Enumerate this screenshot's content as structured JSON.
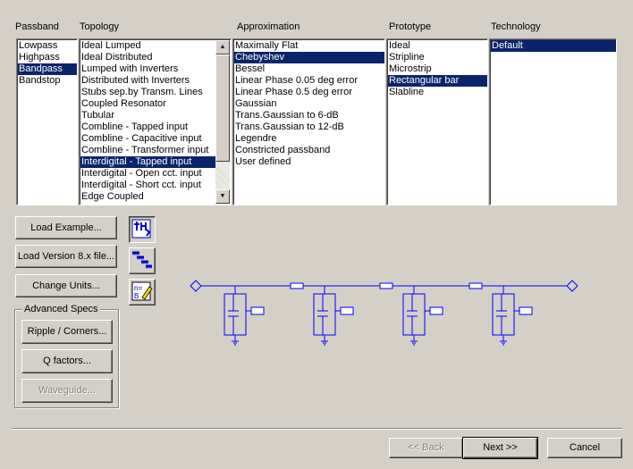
{
  "headers": {
    "passband": "Passband",
    "topology": "Topology",
    "approximation": "Approximation",
    "prototype": "Prototype",
    "technology": "Technology"
  },
  "passband": {
    "items": [
      "Lowpass",
      "Highpass",
      "Bandpass",
      "Bandstop"
    ],
    "selected": "Bandpass"
  },
  "topology": {
    "items": [
      "Ideal Lumped",
      "Ideal Distributed",
      "Lumped with Inverters",
      "Distributed with Inverters",
      "Stubs sep.by Transm. Lines",
      "Coupled Resonator",
      "Tubular",
      "Combline - Tapped input",
      "Combline - Capacitive input",
      "Combline - Transformer input",
      "Interdigital - Tapped input",
      "Interdigital - Open cct. input",
      "Interdigital - Short cct. input",
      "Edge Coupled"
    ],
    "selected": "Interdigital - Tapped input"
  },
  "approximation": {
    "items": [
      "Maximally Flat",
      "Chebyshev",
      "Bessel",
      "Linear Phase 0.05 deg error",
      "Linear Phase 0.5 deg error",
      "Gaussian",
      "Trans.Gaussian to 6-dB",
      "Trans.Gaussian to 12-dB",
      "Legendre",
      "Constricted passband",
      "User defined"
    ],
    "selected": "Chebyshev"
  },
  "prototype": {
    "items": [
      "Ideal",
      "Stripline",
      "Microstrip",
      "Rectangular bar",
      "Slabline"
    ],
    "selected": "Rectangular bar"
  },
  "technology": {
    "items": [
      "Default"
    ],
    "selected": "Default"
  },
  "buttons": {
    "load_example": "Load Example...",
    "load_version": "Load Version 8.x file...",
    "change_units": "Change Units...",
    "ripple": "Ripple / Corners...",
    "q_factors": "Q factors...",
    "waveguide": "Waveguide...",
    "back": "<< Back",
    "next": "Next >>",
    "cancel": "Cancel"
  },
  "advanced_specs_title": "Advanced Specs",
  "icons": {
    "tool1": "filter-response-icon",
    "tool2": "staircase-icon",
    "tool3": "equation-edit-icon"
  },
  "colors": {
    "selection": "#0a246a",
    "schematic": "#0000ff",
    "face": "#d4d0c8"
  }
}
